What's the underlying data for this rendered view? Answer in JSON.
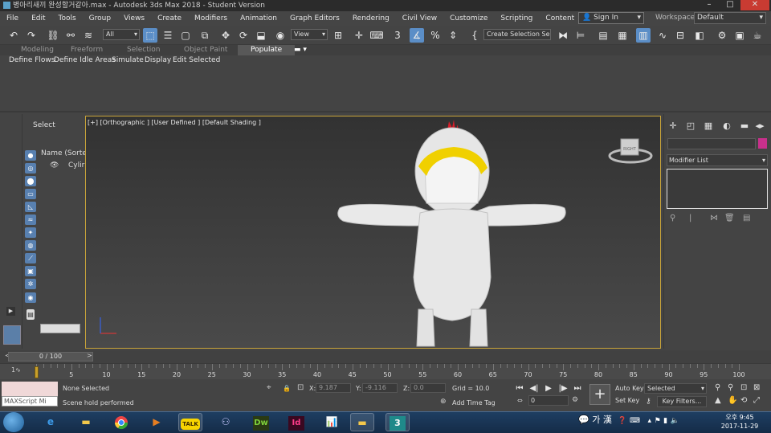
{
  "window": {
    "title": "병아리새끼 완성할거같아.max - Autodesk 3ds Max 2018 - Student Version"
  },
  "menu": {
    "items": [
      "File",
      "Edit",
      "Tools",
      "Group",
      "Views",
      "Create",
      "Modifiers",
      "Animation",
      "Graph Editors",
      "Rendering",
      "Civil View",
      "Customize",
      "Scripting",
      "Content"
    ],
    "sign_in": "Sign In",
    "workspaces_label": "Workspaces:",
    "workspaces_value": "Default"
  },
  "toolbar": {
    "filter": "All",
    "coord_system": "View",
    "selection_set": "Create Selection Se"
  },
  "ribbon": {
    "tabs": [
      "Modeling",
      "Freeform",
      "Selection",
      "Object Paint",
      "Populate"
    ],
    "active_tab": "Populate",
    "subtabs": [
      "Define Flows",
      "Define Idle Areas",
      "Simulate",
      "Display",
      "Edit Selected"
    ]
  },
  "scene_explorer": {
    "select_label": "Select",
    "column_header": "Name (Sorte",
    "row_label": "Cylir"
  },
  "viewport": {
    "label": "[+] [Orthographic ] [User Defined ] [Default Shading ]",
    "viewcube_label": "RIGHT"
  },
  "command_panel": {
    "modifier_list": "Modifier List",
    "color_swatch": "#c8308c"
  },
  "timeline": {
    "slider": "0 / 100",
    "ticks": [
      "0",
      "5",
      "10",
      "15",
      "20",
      "25",
      "30",
      "35",
      "40",
      "45",
      "50",
      "55",
      "60",
      "65",
      "70",
      "75",
      "80",
      "85",
      "90",
      "95",
      "100"
    ]
  },
  "status": {
    "maxscript": "MAXScript Mi",
    "selection": "None Selected",
    "prompt": "Scene hold performed",
    "x_label": "X:",
    "x_value": "9.187",
    "y_label": "Y:",
    "y_value": "-9.116",
    "z_label": "Z:",
    "z_value": "0.0",
    "grid": "Grid = 10.0",
    "add_time_tag": "Add Time Tag",
    "frame": "0",
    "auto_key": "Auto Key",
    "set_key": "Set Key",
    "selected": "Selected",
    "key_filters": "Key Filters..."
  },
  "taskbar": {
    "tray_text": "가 漢",
    "clock_time": "오후 9:45",
    "clock_date": "2017-11-29"
  }
}
